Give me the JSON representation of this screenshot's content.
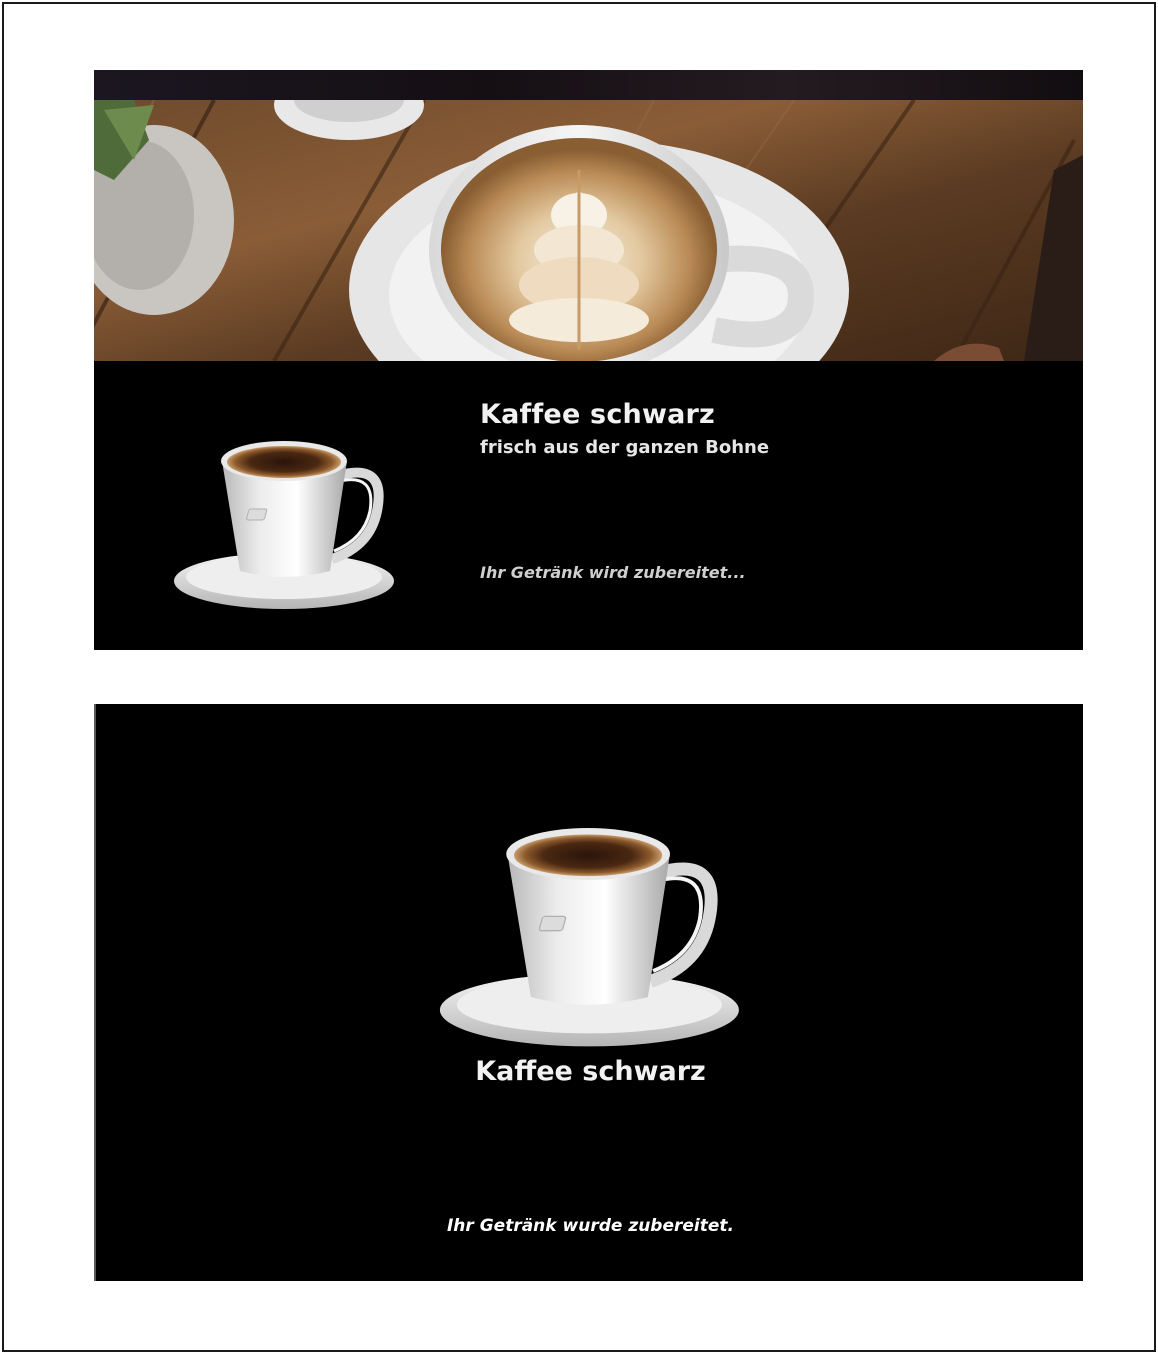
{
  "screen_preparing": {
    "product_title": "Kaffee schwarz",
    "product_subtitle": "frisch aus der ganzen Bohne",
    "status_text": "Ihr Getränk wird zubereitet..."
  },
  "screen_done": {
    "product_title": "Kaffee schwarz",
    "status_text": "Ihr Getränk wurde zubereitet."
  },
  "colors": {
    "background": "#000000",
    "text": "#f2f2f2",
    "status_text_preparing": "#cfcfcf",
    "status_text_done": "#ffffff"
  },
  "icons": {
    "hero_image": "latte-art-cup-photo",
    "product_image": "coffee-cup-icon"
  }
}
